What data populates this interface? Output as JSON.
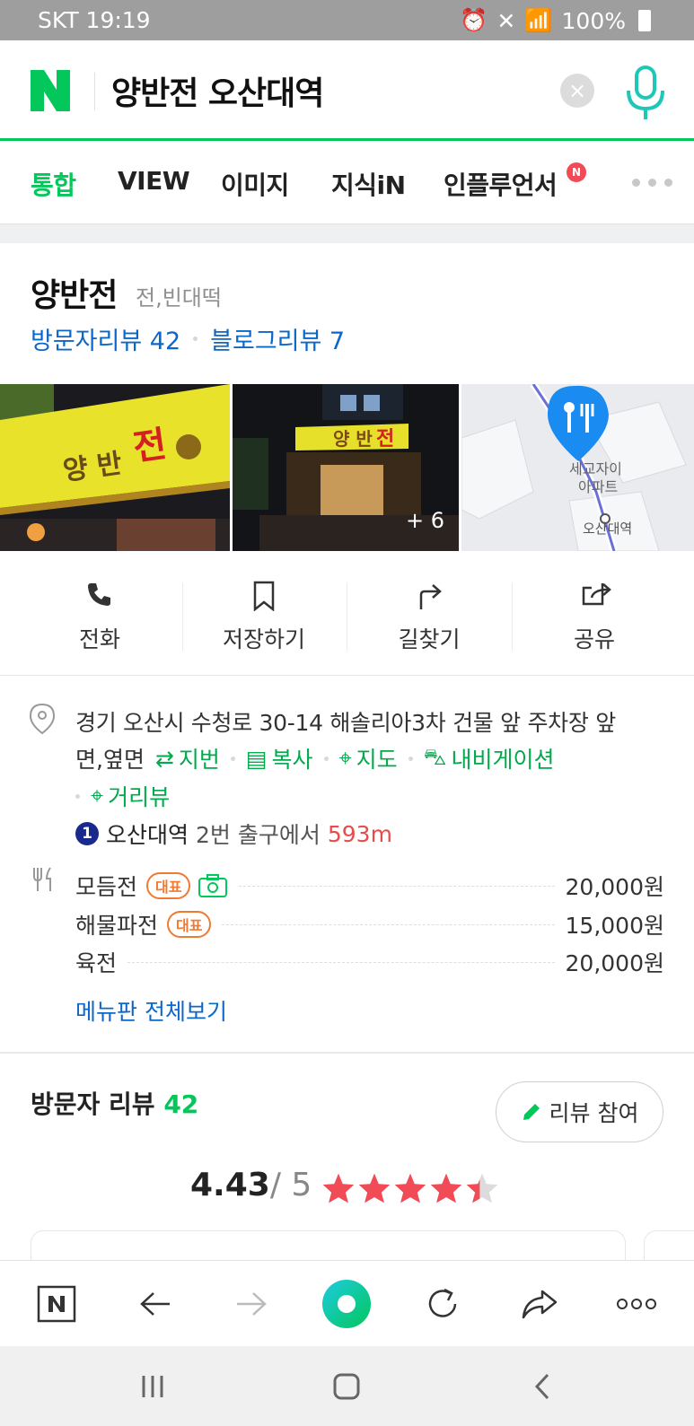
{
  "status_bar": {
    "carrier_time": "SKT 19:19",
    "battery": "100%"
  },
  "search": {
    "query": "양반전 오산대역"
  },
  "tabs": [
    {
      "label": "통합"
    },
    {
      "label": "VIEW"
    },
    {
      "label": "이미지"
    },
    {
      "label": "지식iN"
    },
    {
      "label": "인플루언서",
      "badge": "N"
    }
  ],
  "place": {
    "name": "양반전",
    "category": "전,빈대떡",
    "visitor_reviews": "방문자리뷰 42",
    "blog_reviews": "블로그리뷰 7",
    "photo_more": "+ 6",
    "map_labels": {
      "apt": "세교자이",
      "apt2": "아파트",
      "station": "오산대역"
    }
  },
  "actions": [
    {
      "label": "전화",
      "icon": "phone-icon"
    },
    {
      "label": "저장하기",
      "icon": "bookmark-icon"
    },
    {
      "label": "길찾기",
      "icon": "directions-icon"
    },
    {
      "label": "공유",
      "icon": "share-icon"
    }
  ],
  "address": {
    "line1": "경기 오산시 수청로 30-14 해솔리아3차 건물 앞 주차장 앞",
    "line1_tail": "면,옆면",
    "links": {
      "jibun": "지번",
      "copy": "복사",
      "map": "지도",
      "navi": "내비게이션",
      "street": "거리뷰"
    },
    "subway_line": "1",
    "subway_station": "오산대역",
    "subway_exit": "2번 출구에서",
    "subway_distance": "593m"
  },
  "menu": {
    "items": [
      {
        "name": "모듬전",
        "badge": "대표",
        "price": "20,000원"
      },
      {
        "name": "해물파전",
        "badge": "대표",
        "price": "15,000원"
      },
      {
        "name": "육전",
        "price": "20,000원"
      }
    ],
    "view_all": "메뉴판 전체보기"
  },
  "visitor_review": {
    "title": "방문자 리뷰",
    "count": "42",
    "button": "리뷰 참여",
    "rating": "4.43",
    "rating_max": "/ 5",
    "stars_value": 4.43
  },
  "colors": {
    "naver_green": "#03c75a",
    "link_blue": "#0b67c8",
    "star_red": "#f04b56"
  }
}
